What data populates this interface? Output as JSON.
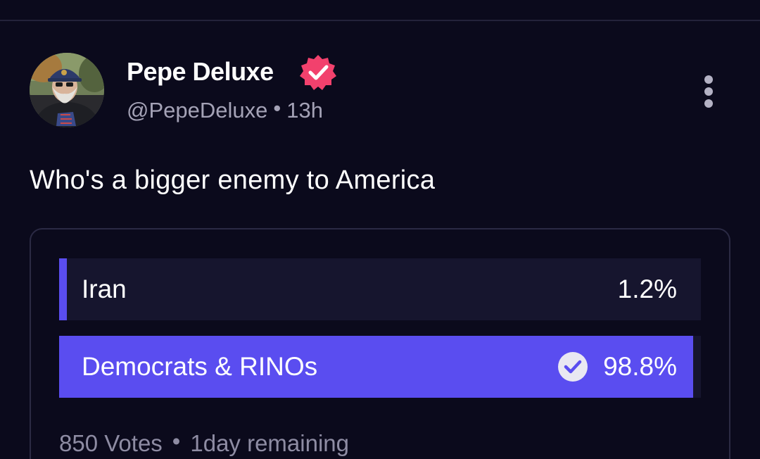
{
  "post": {
    "display_name": "Pepe Deluxe",
    "handle": "@PepeDeluxe",
    "separator": "•",
    "time": "13h",
    "text": "Who's a bigger enemy to America",
    "verified_color": "#f2416d",
    "icons": {
      "avatar": "user-avatar",
      "verified": "verified-badge-icon",
      "more": "more-options-icon"
    }
  },
  "poll": {
    "accent_color": "#5a4df0",
    "options": [
      {
        "label": "Iran",
        "percent_text": "1.2%",
        "fraction": 0.012,
        "selected": false
      },
      {
        "label": "Democrats & RINOs",
        "percent_text": "98.8%",
        "fraction": 0.988,
        "selected": true
      }
    ],
    "votes": "850 Votes",
    "separator": "•",
    "remaining": "1day remaining"
  }
}
